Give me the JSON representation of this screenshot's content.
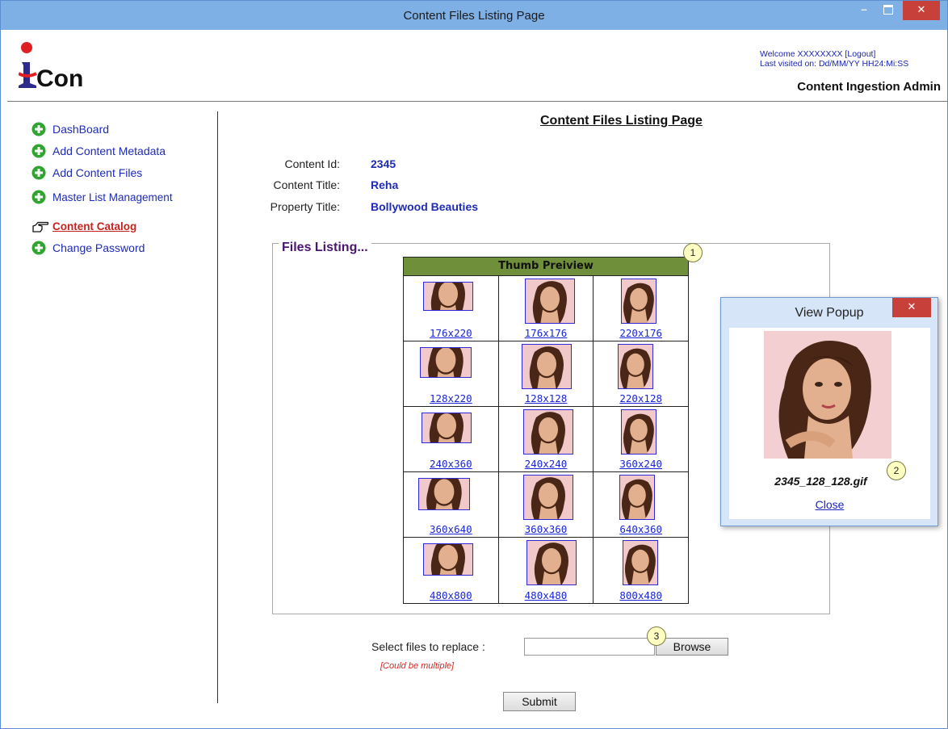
{
  "window": {
    "title": "Content Files Listing Page",
    "min_label": "–",
    "close_label": "✕"
  },
  "header": {
    "logo_text": "Con",
    "welcome_line1": "Welcome XXXXXXXX   [Logout]",
    "welcome_line2": "Last visited on: Dd/MM/YY HH24:Mi:SS",
    "admin_title": "Content Ingestion Admin"
  },
  "sidebar": {
    "items": [
      {
        "label": "DashBoard",
        "icon": "plus-circle-icon"
      },
      {
        "label": "Add Content Metadata",
        "icon": "plus-circle-icon"
      },
      {
        "label": "Add Content Files",
        "icon": "plus-circle-icon"
      },
      {
        "label": "Master List Management",
        "icon": "plus-circle-icon"
      },
      {
        "label": "Content Catalog",
        "icon": "pointing-hand-icon",
        "active": true
      },
      {
        "label": "Change Password",
        "icon": "plus-circle-icon"
      }
    ]
  },
  "main": {
    "heading": "Content Files Listing Page",
    "fields": [
      {
        "label": "Content Id:",
        "value": "2345"
      },
      {
        "label": "Content Title:",
        "value": "Reha"
      },
      {
        "label": "Property Title:",
        "value": "Bollywood Beauties"
      }
    ],
    "files_listing_legend": "Files Listing...",
    "table_header": "Thumb Preiview",
    "thumbnails": [
      [
        "176x220",
        "176x176",
        "220x176"
      ],
      [
        "128x220",
        "128x128",
        "220x128"
      ],
      [
        "240x360",
        "240x240",
        "360x240"
      ],
      [
        "360x640",
        "360x360",
        "640x360"
      ],
      [
        "480x800",
        "480x480",
        "800x480"
      ]
    ],
    "upload_label": "Select files to replace :",
    "upload_hint": "[Could be multiple]",
    "browse_label": "Browse",
    "submit_label": "Submit"
  },
  "popup": {
    "title": "View Popup",
    "close_icon": "✕",
    "filename": "2345_128_128.gif",
    "close_link": "Close"
  },
  "callouts": [
    "1",
    "2",
    "3"
  ],
  "colors": {
    "link_blue": "#1e2bb5",
    "active_red": "#c6231f",
    "table_header_green": "#6f8f3a",
    "legend_purple": "#4a1570",
    "titlebar_blue": "#7fb0e5",
    "close_red": "#c7413a"
  }
}
